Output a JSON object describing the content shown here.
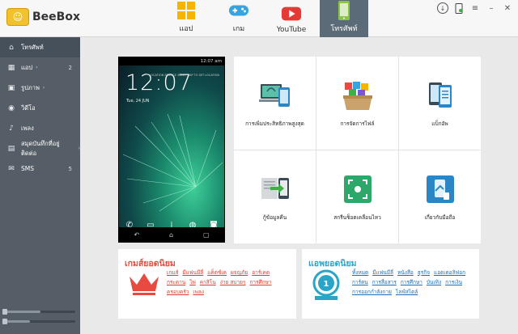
{
  "app": {
    "logo_text": "BeeBox"
  },
  "tabs": [
    {
      "label": "แอป",
      "icon": "apps-grid-icon",
      "active": false
    },
    {
      "label": "เกม",
      "icon": "gamepad-icon",
      "active": false
    },
    {
      "label": "YouTube",
      "icon": "youtube-play-icon",
      "active": false
    },
    {
      "label": "โทรศัพท์",
      "icon": "phone-icon",
      "active": true
    }
  ],
  "window": {
    "download": "download-icon",
    "phone_status": "phone-connected-icon",
    "menu": "menu-icon",
    "minimize": "minimize-icon",
    "close": "close-icon"
  },
  "sidebar": {
    "items": [
      {
        "label": "โทรศัพท์",
        "icon": "home-icon",
        "count": "",
        "active": true
      },
      {
        "label": "แอป",
        "icon": "apps-icon",
        "count": "2",
        "chev": "›"
      },
      {
        "label": "รูปภาพ",
        "icon": "image-icon",
        "count": "",
        "chev": "›"
      },
      {
        "label": "วิดีโอ",
        "icon": "video-icon",
        "count": ""
      },
      {
        "label": "เพลง",
        "icon": "music-icon",
        "count": ""
      },
      {
        "label": "สมุดบันทึกที่อยู่ติดต่อ",
        "icon": "contacts-icon",
        "count": "",
        "chev": "›"
      },
      {
        "label": "SMS",
        "icon": "sms-icon",
        "count": "5"
      }
    ],
    "slider1": 0.5,
    "slider2": 0.35
  },
  "phone": {
    "time": "12:07",
    "status_time": "12:07 am",
    "date": "Tue, 24 JUN",
    "weather": "LOCATION SERVICE SLEEP, TAP TO SET LOCATION"
  },
  "features": [
    {
      "label": "การเพิ่มประสิทธิภาพสูงสุด",
      "icon": "optimize-icon"
    },
    {
      "label": "การจัดการไฟล์",
      "icon": "file-manager-icon"
    },
    {
      "label": "แบ็กอัพ",
      "icon": "backup-icon"
    },
    {
      "label": "กู้ข้อมูลคืน",
      "icon": "restore-icon"
    },
    {
      "label": "สกรีนช็อตเคลื่อนไหว",
      "icon": "screenshot-icon"
    },
    {
      "label": "เกี่ยวกับมือถือ",
      "icon": "about-phone-icon"
    }
  ],
  "games_panel": {
    "title": "เกมส์ยอดนิยม",
    "links": [
      "เกมส์",
      "มีแฟนมีลี่",
      "แค็ตช์เค",
      "ผจญภัย",
      "อาร์เคด",
      "กระดาน",
      "ไพ่",
      "คาสิโน",
      "ง่าย สบายๆ",
      "การศึกษา",
      "ครอบครัว",
      "เพลง"
    ]
  },
  "apps_panel": {
    "title": "แอพยอดนิยม",
    "links": [
      "ทั้งหมด",
      "มีแฟนมีลี่",
      "หนังสือ",
      "ธุรกิจ",
      "แอดเดอลิฟอก",
      "การ์ตน",
      "การสื่อสาร",
      "การศึกษา",
      "บันเทิง",
      "การเงิน",
      "การออกกำลังกาย",
      "ไลฟ์สไตล์"
    ]
  }
}
